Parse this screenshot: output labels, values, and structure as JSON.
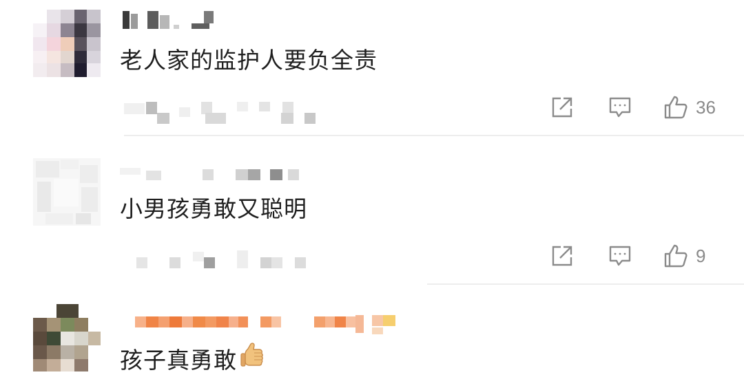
{
  "comments": [
    {
      "text": "老人家的监护人要负全责",
      "likes": "36"
    },
    {
      "text": "小男孩勇敢又聪明",
      "likes": "9"
    },
    {
      "text": "孩子真勇敢",
      "emoji": "thumbs-up-icon"
    }
  ],
  "colors": {
    "text": "#1f1f1f",
    "icon": "#8a8a8a",
    "divider": "#ededed",
    "username_orange": "#f08a3c"
  }
}
